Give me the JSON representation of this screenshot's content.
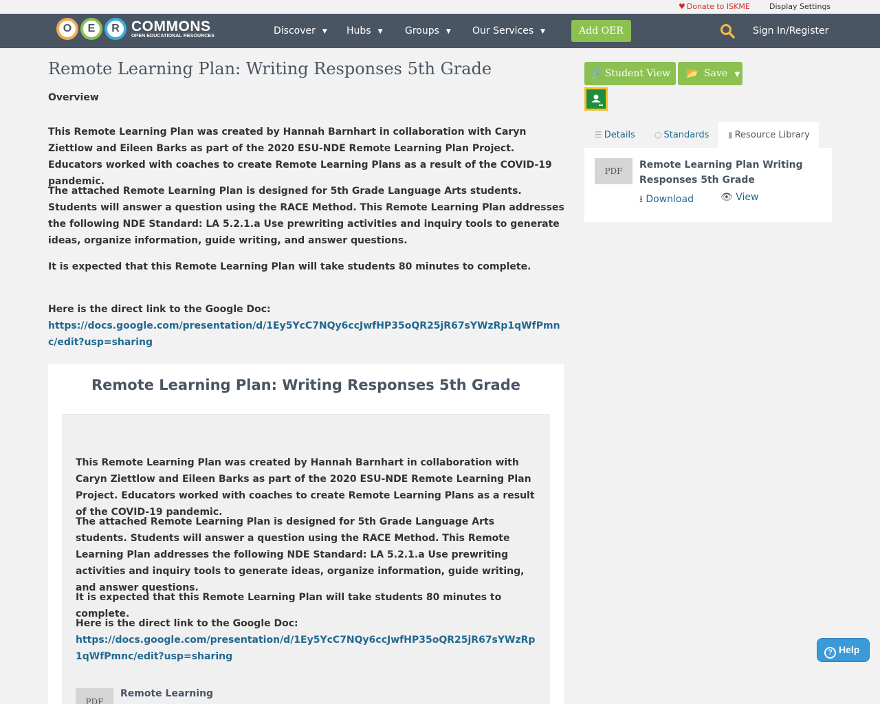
{
  "utility": {
    "donate": "Donate to ISKME",
    "display_settings": "Display Settings"
  },
  "logo": {
    "letters": [
      "O",
      "E",
      "R"
    ],
    "name": "COMMONS",
    "tagline": "OPEN EDUCATIONAL RESOURCES"
  },
  "nav": {
    "items": [
      "Discover",
      "Hubs",
      "Groups",
      "Our Services"
    ],
    "add_oer": "Add OER",
    "signin": "Sign In/Register"
  },
  "main": {
    "title": "Remote Learning Plan: Writing Responses 5th Grade",
    "overview_label": "Overview",
    "paragraphs": [
      "This Remote Learning Plan was created by Hannah Barnhart in collaboration with Caryn Ziettlow and Eileen Barks as part of the 2020 ESU-NDE Remote Learning Plan Project. Educators worked with coaches to create Remote Learning Plans as a result of the COVID-19 pandemic.",
      "The attached Remote Learning Plan is designed for 5th Grade Language Arts students. Students will answer a question using the RACE Method. This Remote Learning Plan addresses the following NDE Standard: LA 5.2.1.a Use prewriting activities and inquiry tools to generate ideas, organize information, guide writing, and answer questions.",
      "It is expected that this Remote Learning Plan will take students 80 minutes to complete."
    ],
    "link_intro": "Here is the direct link to the Google Doc:",
    "link": "https://docs.google.com/presentation/d/1Ey5YcC7NQy6ccJwfHP35oQR25jR67sYWzRp1qWfPmnc/edit?usp=sharing"
  },
  "card": {
    "title": "Remote Learning Plan: Writing Responses 5th Grade",
    "pdf_label": "PDF",
    "pdf_title": "Remote Learning"
  },
  "sidebar": {
    "student_view": "Student View",
    "save": "Save",
    "tabs": [
      "Details",
      "Standards",
      "Resource Library"
    ],
    "resource": {
      "type": "PDF",
      "title": "Remote Learning Plan Writing Responses 5th Grade",
      "download": "Download",
      "view": "View"
    }
  },
  "help": "Help"
}
